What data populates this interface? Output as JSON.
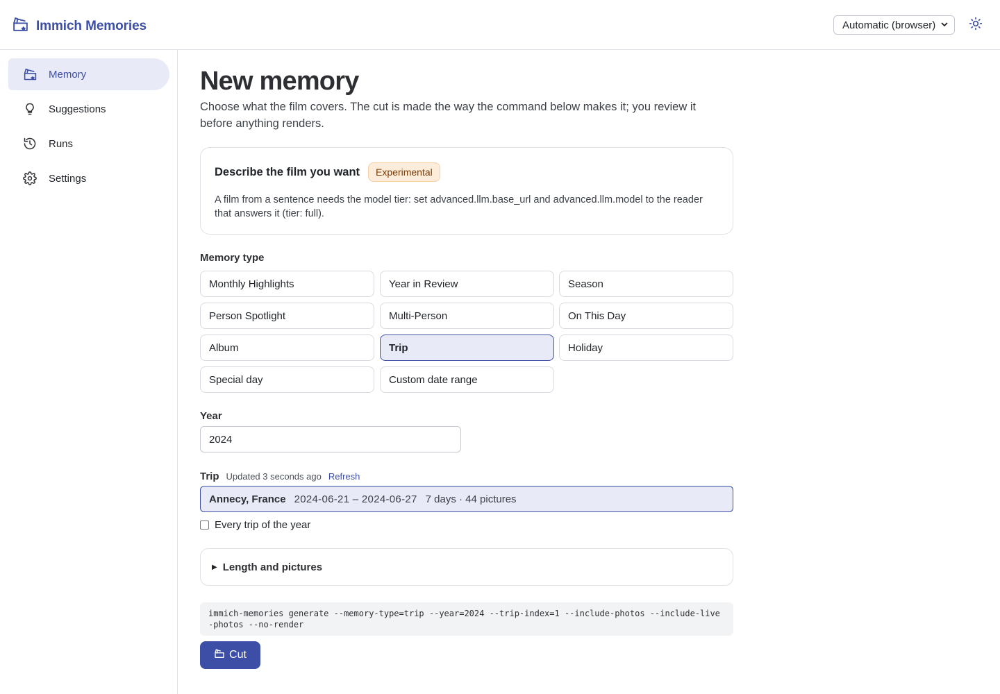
{
  "app": {
    "title": "Immich Memories",
    "theme_select": {
      "value": "Automatic (browser)"
    },
    "icons": {
      "brand": "film-clapper-icon",
      "theme": "sun-icon"
    }
  },
  "sidebar": {
    "items": [
      {
        "label": "Memory",
        "icon": "film-clapper-icon",
        "active": true
      },
      {
        "label": "Suggestions",
        "icon": "lightbulb-icon",
        "active": false
      },
      {
        "label": "Runs",
        "icon": "history-icon",
        "active": false
      },
      {
        "label": "Settings",
        "icon": "gear-icon",
        "active": false
      }
    ]
  },
  "page": {
    "title": "New memory",
    "description": "Choose what the film covers. The cut is made the way the command below makes it; you review it before anything renders."
  },
  "describe_card": {
    "title": "Describe the film you want",
    "badge": "Experimental",
    "text": "A film from a sentence needs the model tier: set advanced.llm.base_url and advanced.llm.model to the reader that answers it (tier: full)."
  },
  "memory_type": {
    "label": "Memory type",
    "options": [
      "Monthly Highlights",
      "Year in Review",
      "Season",
      "Person Spotlight",
      "Multi-Person",
      "On This Day",
      "Album",
      "Trip",
      "Holiday",
      "Special day",
      "Custom date range"
    ],
    "selected": "Trip"
  },
  "year": {
    "label": "Year",
    "value": "2024"
  },
  "trip": {
    "label": "Trip",
    "updated": "Updated 3 seconds ago",
    "refresh": "Refresh",
    "selected_name": "Annecy, France",
    "selected_dates": "2024-06-21 – 2024-06-27",
    "selected_meta": "7 days · 44 pictures",
    "every_trip_label": "Every trip of the year",
    "every_trip_checked": false
  },
  "length_section": {
    "label": "Length and pictures"
  },
  "command": "immich-memories generate --memory-type=trip --year=2024 --trip-index=1 --include-photos --include-live-photos --no-render",
  "cut_button": {
    "label": "Cut",
    "icon": "cut-icon"
  },
  "colors": {
    "accent": "#3d4ea6",
    "accent_light": "#e8eaf7",
    "badge_bg": "#fdecd9"
  }
}
